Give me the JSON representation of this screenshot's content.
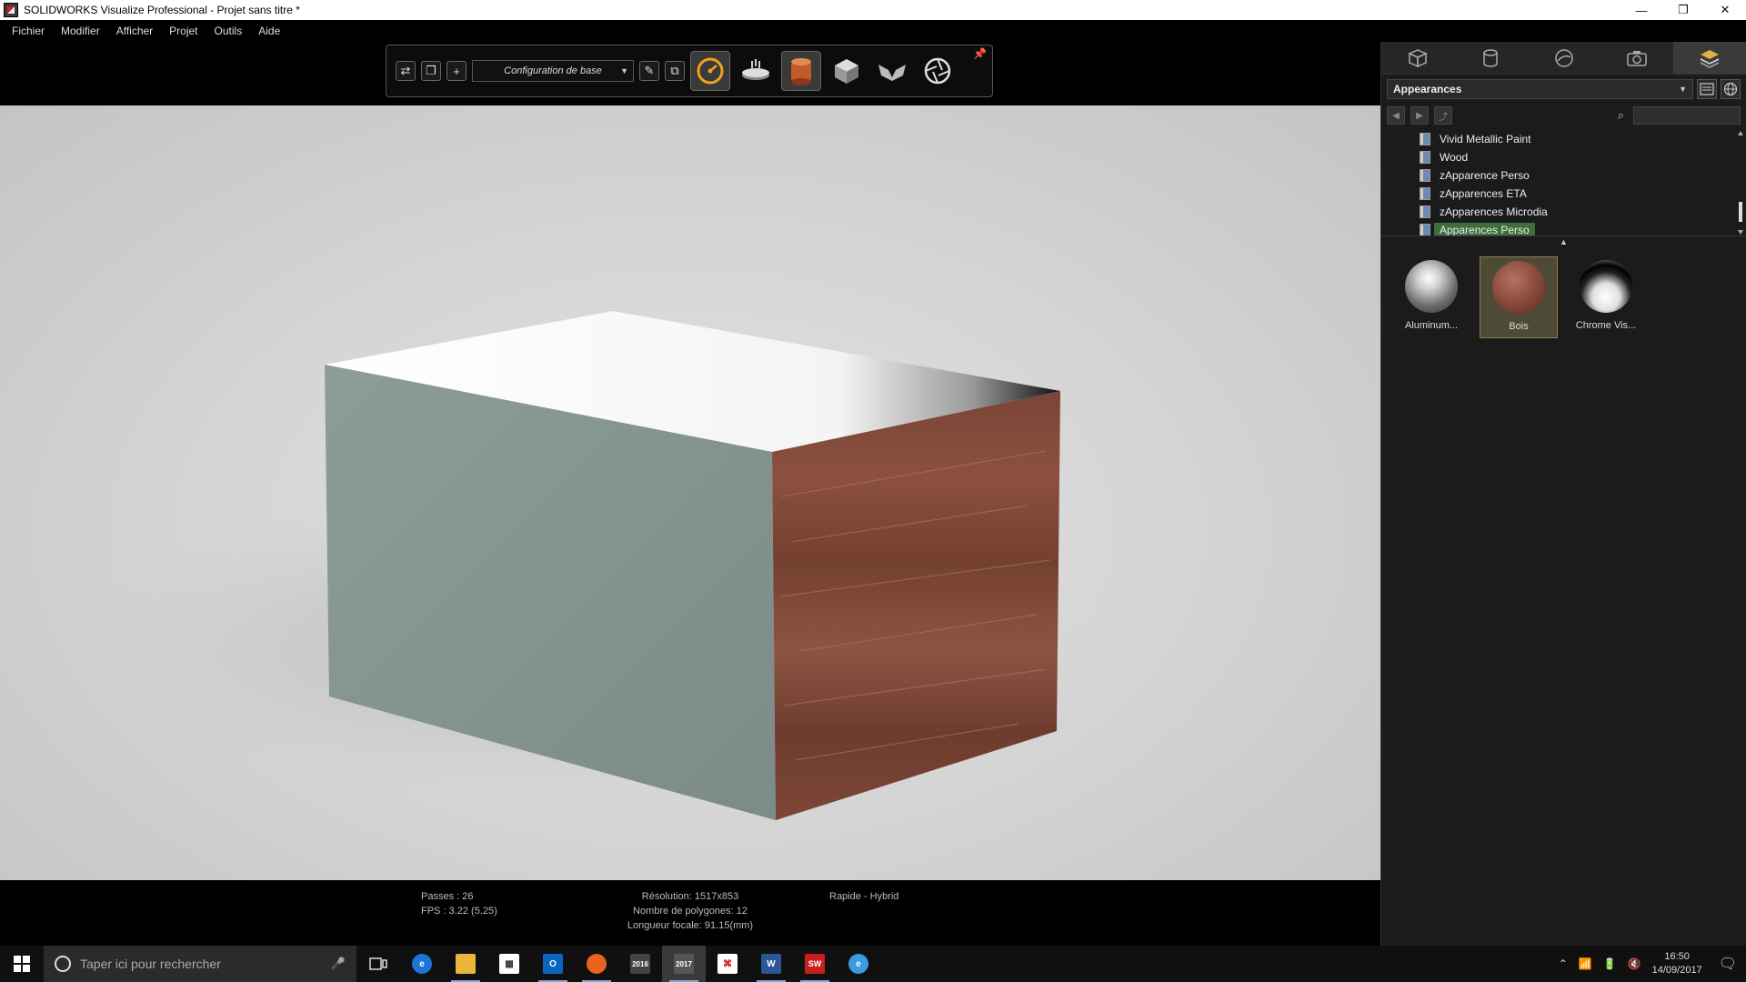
{
  "window": {
    "title": "SOLIDWORKS Visualize Professional - Projet sans titre *",
    "minimize": "—",
    "restore": "❐",
    "close": "✕"
  },
  "menu": [
    "Fichier",
    "Modifier",
    "Afficher",
    "Projet",
    "Outils",
    "Aide"
  ],
  "toolbar": {
    "configuration": "Configuration de base",
    "icons": [
      "swap-icon",
      "copy-icon",
      "add-icon",
      "edit-icon",
      "duplicate-icon",
      "speed-render-icon",
      "turntable-icon",
      "environment-icon",
      "model-icon",
      "camera-view-icon",
      "aperture-icon",
      "pin-icon"
    ]
  },
  "status": {
    "passes": "Passes : 26",
    "fps": "FPS : 3.22 (5.25)",
    "resolution": "Résolution: 1517x853",
    "polygons": "Nombre de polygones: 12",
    "focal": "Longueur focale: 91.15(mm)",
    "mode": "Rapide - Hybrid"
  },
  "panel": {
    "tabs": [
      "model-tab-icon",
      "appearance-tab-icon",
      "environment-tab-icon",
      "camera-tab-icon",
      "libraries-tab-icon"
    ],
    "active_tab": 4,
    "dropdown": "Appearances",
    "search_placeholder": "",
    "tree": [
      {
        "label": "Vivid Metallic Paint",
        "selected": false
      },
      {
        "label": "Wood",
        "selected": false
      },
      {
        "label": "zApparence Perso",
        "selected": false
      },
      {
        "label": "zApparences ETA",
        "selected": false
      },
      {
        "label": "zApparences Microdia",
        "selected": false
      },
      {
        "label": "Apparences Perso",
        "selected": true
      }
    ],
    "thumbnails": [
      {
        "label": "Aluminum...",
        "selected": false
      },
      {
        "label": "Bois",
        "selected": true
      },
      {
        "label": "Chrome Vis...",
        "selected": false
      }
    ]
  },
  "taskbar": {
    "search_placeholder": "Taper ici pour rechercher",
    "apps": [
      {
        "name": "task-view-icon",
        "label": "",
        "color": "#101010"
      },
      {
        "name": "edge-icon",
        "label": "e",
        "color": "#1e73d8"
      },
      {
        "name": "file-explorer-icon",
        "label": "",
        "color": "#e8b73a"
      },
      {
        "name": "store-icon",
        "label": "",
        "color": "#ffffff"
      },
      {
        "name": "outlook-icon",
        "label": "O",
        "color": "#0a64c0"
      },
      {
        "name": "firefox-icon",
        "label": "",
        "color": "#e8641e"
      },
      {
        "name": "visualize-2016-icon",
        "label": "2016",
        "color": "#444444"
      },
      {
        "name": "visualize-2017-icon",
        "label": "2017",
        "color": "#555555"
      },
      {
        "name": "acrobat-icon",
        "label": "",
        "color": "#ffffff"
      },
      {
        "name": "word-icon",
        "label": "W",
        "color": "#2b5797"
      },
      {
        "name": "solidworks-icon",
        "label": "SW",
        "color": "#c8201e"
      },
      {
        "name": "ie-icon",
        "label": "e",
        "color": "#3a9be0"
      }
    ],
    "time": "16:50",
    "date": "14/09/2017"
  }
}
